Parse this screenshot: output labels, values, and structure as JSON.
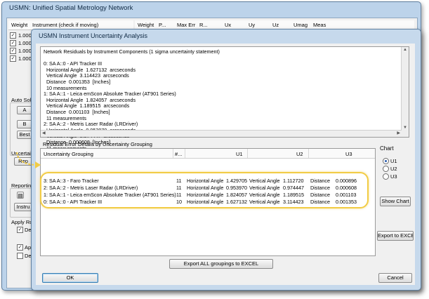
{
  "back_window": {
    "title": "USMN: Unified Spatial Metrology Network",
    "columns_left": [
      "Weight",
      "Instrument (check if moving)"
    ],
    "columns_right": [
      "Weight",
      "P...",
      "Max Err",
      "R...",
      "Ux",
      "Uy",
      "Uz",
      "Umag",
      "Meas"
    ],
    "rows": [
      "1.000",
      "1.000",
      "1.000",
      "1.000"
    ],
    "partial_labels": {
      "auto_solve": "Auto Sol",
      "uncertainty": "Uncertai",
      "reporting": "Reportin",
      "apply": "Apply Ro",
      "dev": "Devi",
      "b1": "A",
      "b2": "B",
      "b3": "Best",
      "b4": "Rep",
      "b5": "Instru",
      "c1": "Dere",
      "c2": "Appl"
    }
  },
  "dialog": {
    "title": "USMN Instrument Uncertainty Analysis",
    "network_text": "Network Residuals by Instrument Components (1 sigma uncertainty statement)\n\n0: SA A::0 - API Tracker III\n  Horizontal Angle  1.627132  arcseconds\n  Vertical Angle  3.114423  arcseconds\n  Distance  0.001353  [Inches]\n  10 measurements\n1: SA A::1 - Leica emScon Absolute Tracker (AT901 Series)\n  Horizontal Angle  1.824057  arcseconds\n  Vertical Angle  1.189515  arcseconds\n  Distance  0.001103  [Inches]\n  11 measurements\n2: SA A::2 - Metris Laser Radar (LRDriver)\n  Horizontal Angle  0.953970  arcseconds\n  Vertical Angle  0.974447  arcseconds\n  Distance  0.000608  [Inches]\n  11 measurements\n3: SA A::3 - Faro Tracker",
    "residual_section_label": "Residual Error Details by Uncertainty Grouping",
    "grid_headers": [
      "Uncertainty Grouping",
      "#...",
      "U1",
      "U2",
      "U3"
    ],
    "grid_rows": [
      {
        "group": "3: SA A::3 - Faro Tracker",
        "n": "11",
        "c1": "Horizontal Angle",
        "u1": "1.429705",
        "c2": "Vertical Angle",
        "u2": "1.112720",
        "c3": "Distance",
        "u3": "0.000896"
      },
      {
        "group": "2: SA A::2 - Metris Laser Radar (LRDriver)",
        "n": "11",
        "c1": "Horizontal Angle",
        "u1": "0.953970",
        "c2": "Vertical Angle",
        "u2": "0.974447",
        "c3": "Distance",
        "u3": "0.000608"
      },
      {
        "group": "1: SA A::1 - Leica emScon Absolute Tracker (AT901 Series)",
        "n": "11",
        "c1": "Horizontal Angle",
        "u1": "1.824057",
        "c2": "Vertical Angle",
        "u2": "1.189515",
        "c3": "Distance",
        "u3": "0.001103"
      },
      {
        "group": "0: SA A::0 - API Tracker III",
        "n": "10",
        "c1": "Horizontal Angle",
        "u1": "1.627132",
        "c2": "Vertical Angle",
        "u2": "3.114423",
        "c3": "Distance",
        "u3": "0.001353"
      }
    ],
    "chart_label": "Chart",
    "radio_options": [
      "U1",
      "U2",
      "U3"
    ],
    "show_chart": "Show Chart",
    "export_excel": "Export to EXCEL",
    "export_all": "Export ALL groupings to EXCEL",
    "ok": "OK",
    "cancel": "Cancel"
  },
  "colors": {
    "highlight": "#f2cc45",
    "title_bar": "#c6d9ec"
  }
}
